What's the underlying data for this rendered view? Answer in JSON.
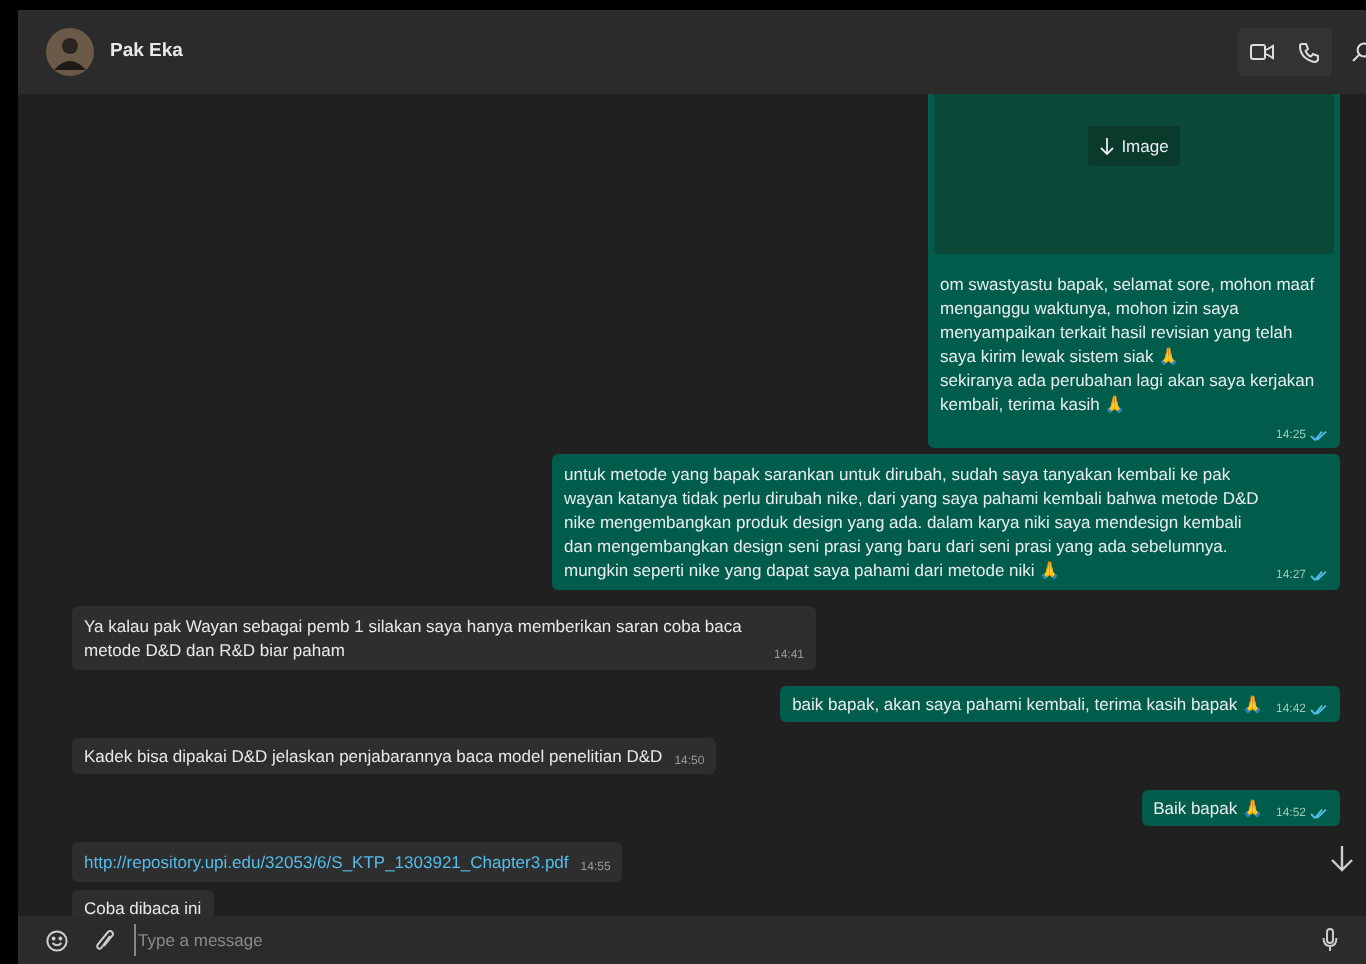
{
  "contact": {
    "name": "Pak Eka"
  },
  "messages": [
    {
      "kind": "image",
      "outgoing": true,
      "button": "Image",
      "text": "om swastyastu bapak, selamat sore, mohon maaf menganggu waktunya, mohon izin saya menyampaikan terkait hasil revisian yang telah saya kirim lewak sistem siak 🙏\nsekiranya ada perubahan lagi akan saya kerjakan kembali, terima kasih 🙏",
      "time": "14:25",
      "read": true
    },
    {
      "kind": "text",
      "outgoing": true,
      "text": "untuk metode yang bapak sarankan untuk dirubah, sudah saya tanyakan kembali ke pak wayan katanya tidak perlu dirubah nike, dari yang saya pahami kembali bahwa metode D&D nike mengembangkan produk design yang ada. dalam karya niki saya mendesign kembali dan mengembangkan design seni prasi yang baru dari seni prasi yang ada sebelumnya. mungkin seperti nike yang dapat saya pahami dari metode niki 🙏",
      "time": "14:27",
      "read": true
    },
    {
      "kind": "text",
      "outgoing": false,
      "text": "Ya kalau pak Wayan sebagai pemb 1 silakan saya hanya memberikan saran coba baca metode D&D dan R&D biar paham",
      "time": "14:41"
    },
    {
      "kind": "text",
      "outgoing": true,
      "text": "baik bapak, akan saya pahami kembali, terima kasih bapak 🙏",
      "time": "14:42",
      "read": true
    },
    {
      "kind": "text",
      "outgoing": false,
      "text": "Kadek bisa dipakai D&D jelaskan penjabarannya baca model penelitian D&D",
      "time": "14:50"
    },
    {
      "kind": "text",
      "outgoing": true,
      "text": "Baik bapak 🙏",
      "time": "14:52",
      "read": true
    },
    {
      "kind": "link",
      "outgoing": false,
      "text": "http://repository.upi.edu/32053/6/S_KTP_1303921_Chapter3.pdf",
      "time": "14:55"
    },
    {
      "kind": "text",
      "outgoing": false,
      "text": "Coba dibaca ini"
    }
  ],
  "composer": {
    "placeholder": "Type a message"
  }
}
